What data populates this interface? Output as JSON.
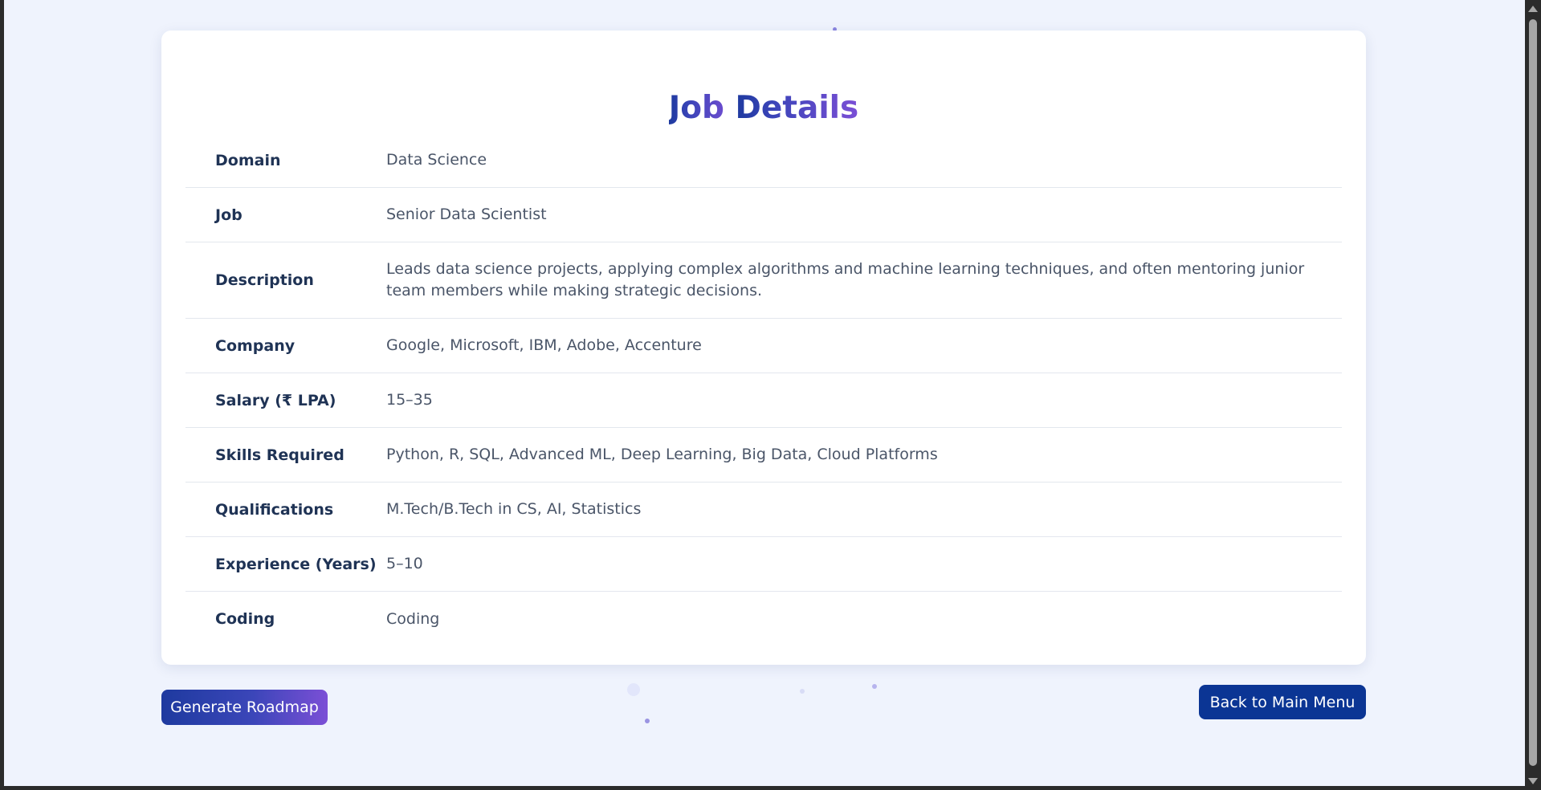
{
  "page": {
    "title_part1": "Job ",
    "title_part2": "Details"
  },
  "rows": [
    {
      "label": "Domain",
      "value": "Data Science"
    },
    {
      "label": "Job",
      "value": "Senior Data Scientist"
    },
    {
      "label": "Description",
      "value": "Leads data science projects, applying complex algorithms and machine learning techniques, and often mentoring junior team members while making strategic decisions."
    },
    {
      "label": "Company",
      "value": "Google, Microsoft, IBM, Adobe, Accenture"
    },
    {
      "label": "Salary (₹ LPA)",
      "value": "15–35"
    },
    {
      "label": "Skills Required",
      "value": "Python, R, SQL, Advanced ML, Deep Learning, Big Data, Cloud Platforms"
    },
    {
      "label": "Qualifications",
      "value": "M.Tech/B.Tech in CS, AI, Statistics"
    },
    {
      "label": "Experience (Years)",
      "value": "5–10"
    },
    {
      "label": "Coding",
      "value": "Coding"
    }
  ],
  "actions": {
    "generate_label": "Generate Roadmap",
    "back_label": "Back to Main Menu"
  },
  "colors": {
    "background": "#eff3fd",
    "title_gradient_start": "#1e3a9f",
    "title_gradient_end": "#7b4fd6",
    "back_button": "#0b3594"
  }
}
